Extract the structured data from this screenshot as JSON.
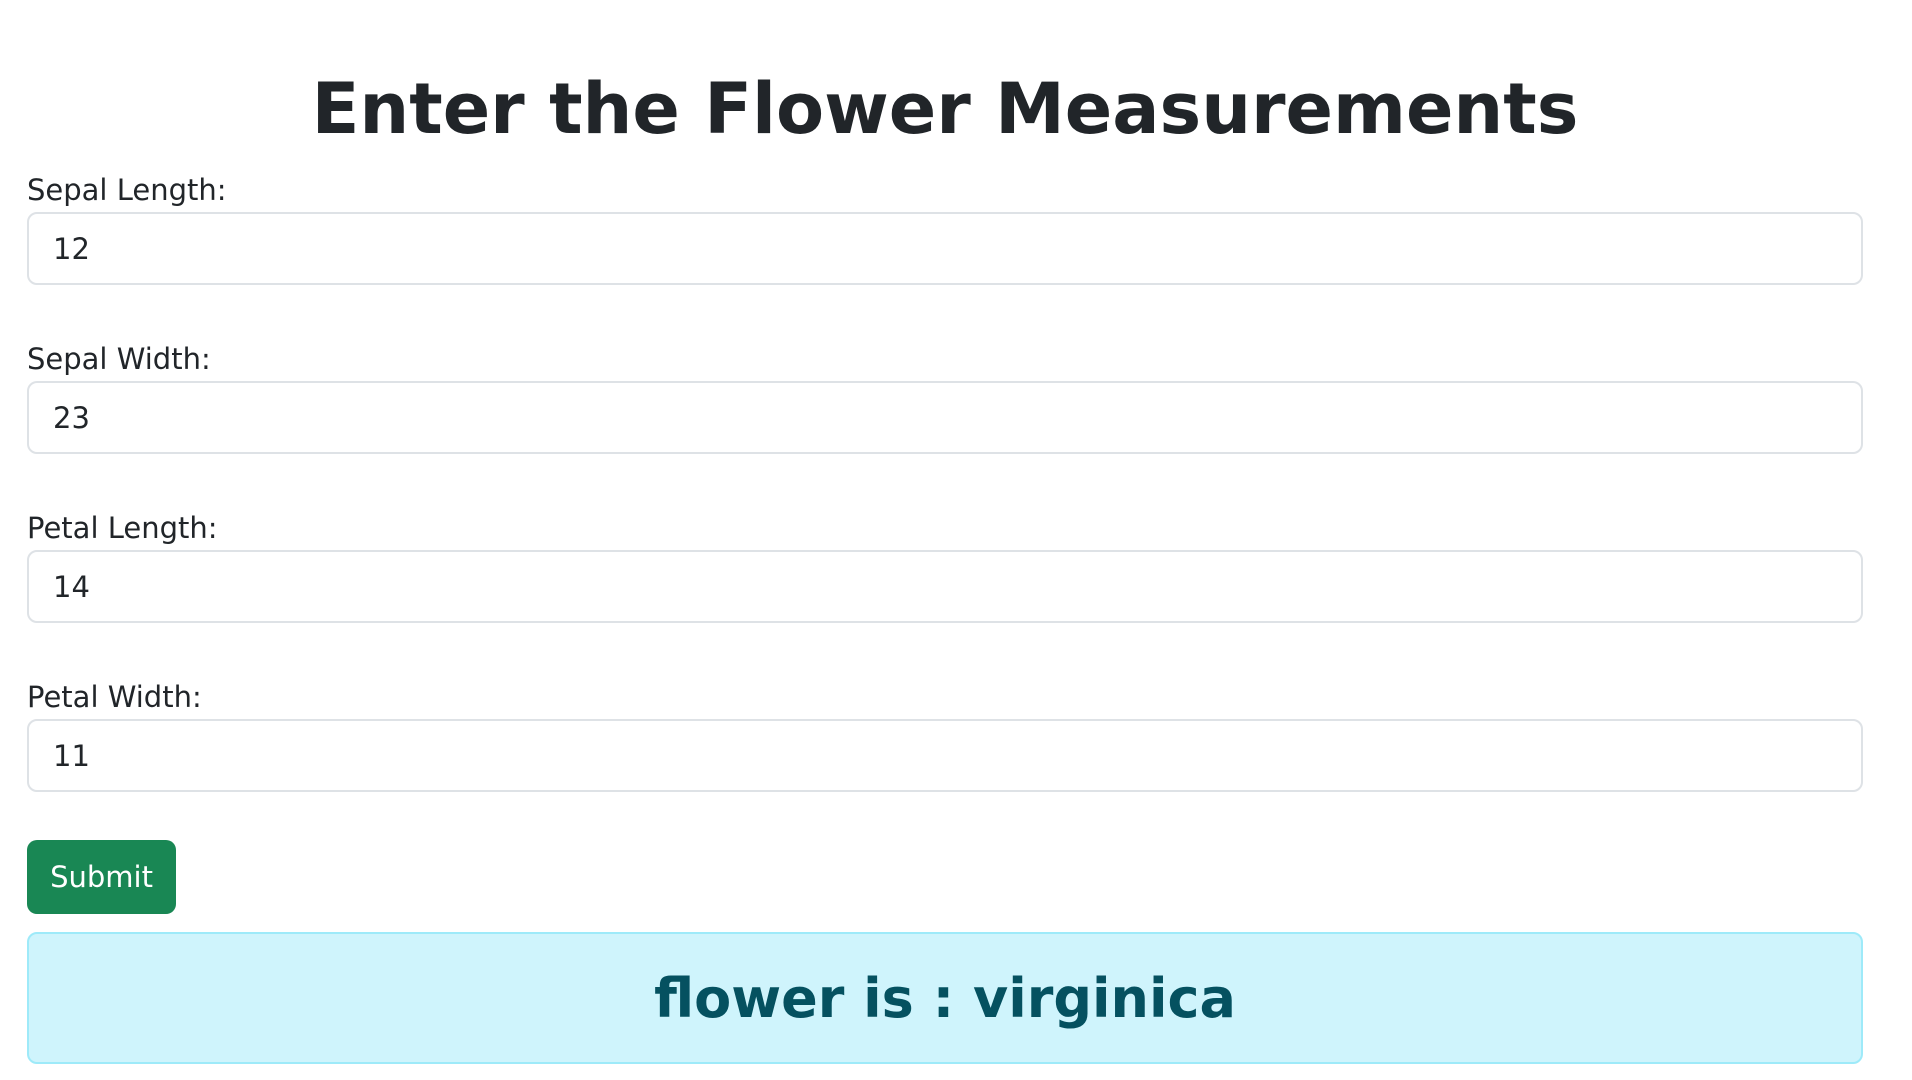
{
  "page": {
    "title": "Enter the Flower Measurements"
  },
  "form": {
    "fields": [
      {
        "label": "Sepal Length:",
        "value": "12"
      },
      {
        "label": "Sepal Width:",
        "value": "23"
      },
      {
        "label": "Petal Length:",
        "value": "14"
      },
      {
        "label": "Petal Width:",
        "value": "11"
      }
    ],
    "submit_label": "Submit"
  },
  "result": {
    "text": "flower is : virginica"
  },
  "colors": {
    "submit_button": "#198754",
    "alert_background": "#cff4fc",
    "alert_border": "#9eeaf9",
    "alert_text": "#055160"
  }
}
